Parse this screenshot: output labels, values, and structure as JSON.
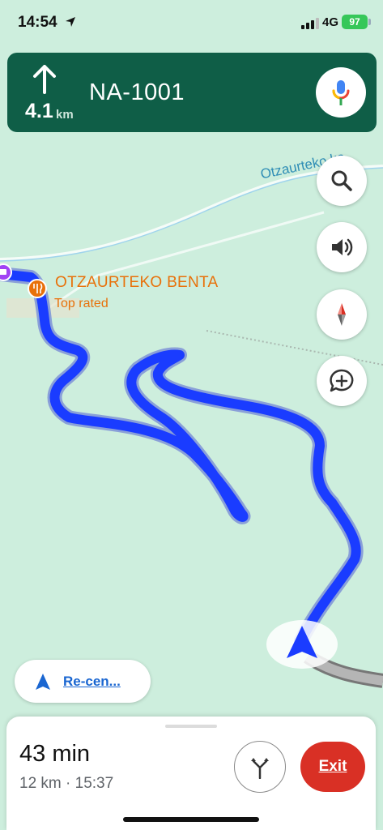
{
  "status_bar": {
    "time": "14:54",
    "network": "4G",
    "battery": "97",
    "icons": [
      "location-arrow-icon",
      "signal-icon",
      "battery-icon"
    ]
  },
  "navigation": {
    "next_turn_icon": "straight-arrow-icon",
    "distance_value": "4.1",
    "distance_unit": "km",
    "road_name": "NA-1001",
    "mic_icon": "microphone-icon"
  },
  "map": {
    "poi_name": "OTZAURTEKO BENTA",
    "poi_subtitle": "Top rated",
    "poi_icon": "restaurant-icon",
    "street_label": "Otzaurteko ka",
    "route_color": "#1a3cff",
    "buttons": [
      "search-icon",
      "sound-icon",
      "compass-icon",
      "add-report-icon"
    ]
  },
  "recenter": {
    "label": "Re-cen...",
    "icon": "navigation-arrow-icon"
  },
  "trip": {
    "duration": "43 min",
    "details": "12 km · 15:37",
    "routes_icon": "alternate-routes-icon",
    "exit_label": "Exit",
    "exit_color": "#d93025"
  }
}
